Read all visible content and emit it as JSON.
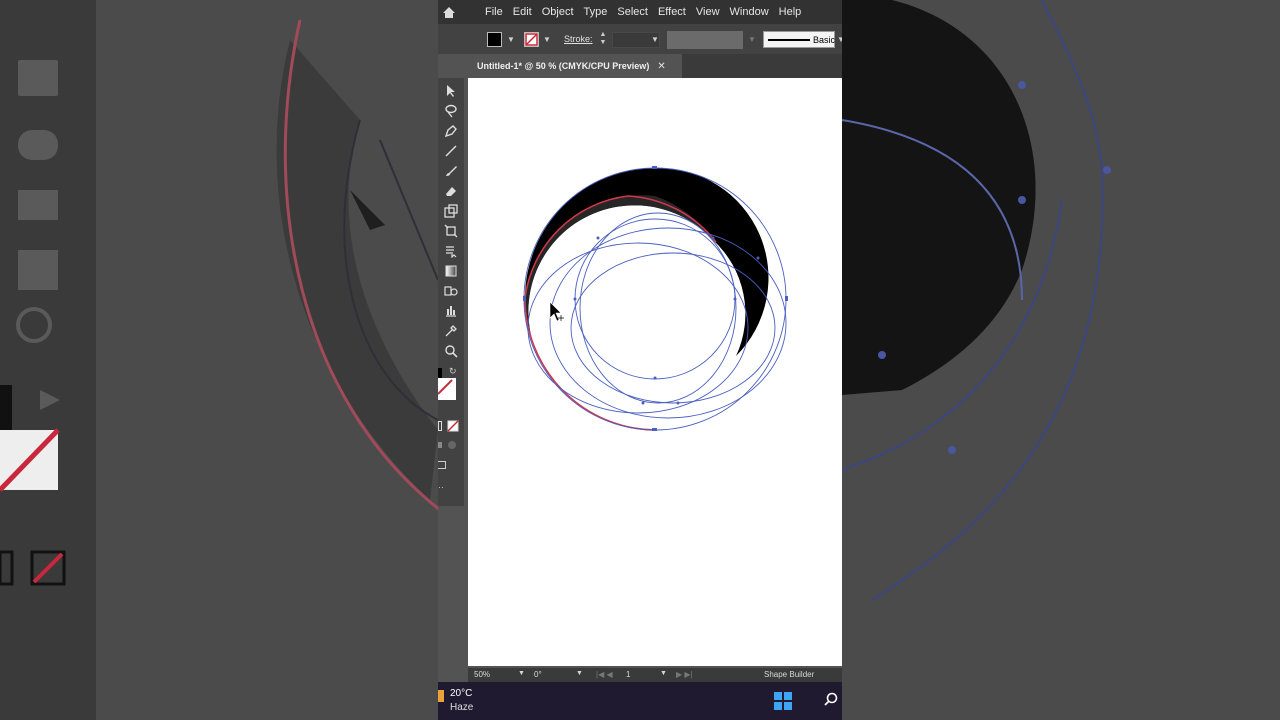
{
  "menubar": {
    "items": [
      "File",
      "Edit",
      "Object",
      "Type",
      "Select",
      "Effect",
      "View",
      "Window",
      "Help"
    ]
  },
  "controlbar": {
    "stroke_label": "Stroke:",
    "profile_label": "Basic"
  },
  "document_tab": {
    "title": "Untitled-1* @ 50 % (CMYK/CPU Preview)",
    "close_glyph": "✕"
  },
  "statusbar": {
    "zoom": "50%",
    "rotation": "0°",
    "artboard_number": "1",
    "current_tool": "Shape Builder"
  },
  "taskbar": {
    "temperature": "20°C",
    "condition": "Haze"
  },
  "colors": {
    "menubar_bg": "#323232",
    "panel_bg": "#424242",
    "workspace_bg": "#535353",
    "selection_blue": "#4a6bd8",
    "highlight_red": "#d2384b"
  },
  "icons": [
    "home-icon",
    "selection-tool-icon",
    "lasso-tool-icon",
    "pen-tool-icon",
    "line-tool-icon",
    "paintbrush-tool-icon",
    "eraser-tool-icon",
    "scale-tool-icon",
    "free-transform-icon",
    "shape-builder-icon",
    "gradient-tool-icon",
    "symbol-sprayer-icon",
    "graph-tool-icon",
    "eyedropper-tool-icon",
    "zoom-tool-icon",
    "windows-start-icon",
    "search-icon"
  ]
}
